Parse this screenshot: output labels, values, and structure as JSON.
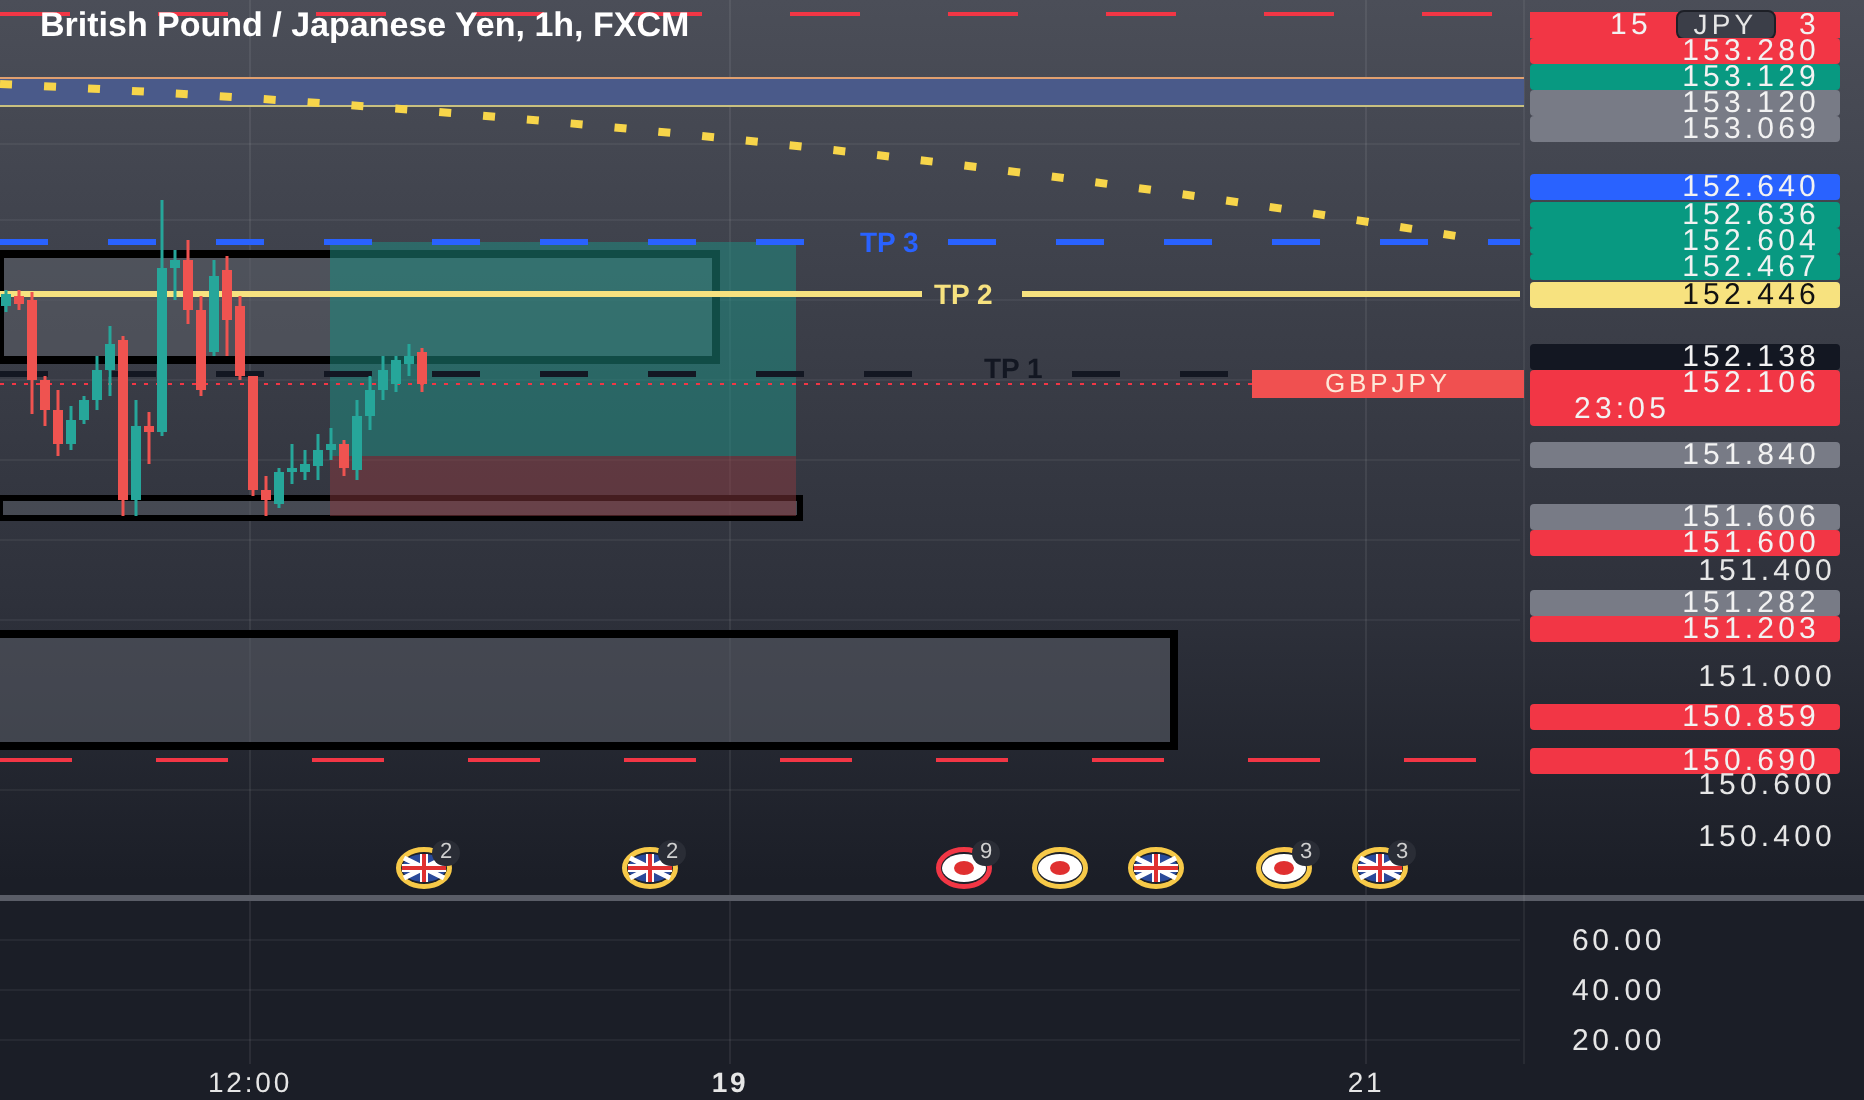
{
  "title": "British Pound / Japanese Yen, 1h, FXCM",
  "price_axis": [
    {
      "kind": "split",
      "color": "#f23645",
      "text": "15",
      "text_end": "3",
      "badge": "JPY"
    },
    {
      "kind": "tag",
      "color": "#f23645",
      "text": "153.280"
    },
    {
      "kind": "tag",
      "color": "#089981",
      "text": "153.129"
    },
    {
      "kind": "tag",
      "color": "#787b86",
      "text": "153.120"
    },
    {
      "kind": "tag",
      "color": "#787b86",
      "text": "153.069"
    },
    {
      "kind": "tag",
      "color": "#2962ff",
      "text": "152.640"
    },
    {
      "kind": "tag",
      "color": "#089981",
      "text": "152.636"
    },
    {
      "kind": "tag",
      "color": "#089981",
      "text": "152.604"
    },
    {
      "kind": "tag",
      "color": "#089981",
      "text": "152.467"
    },
    {
      "kind": "tag",
      "color": "#f7e27f",
      "text": "152.446"
    },
    {
      "kind": "tag",
      "color": "#131722",
      "text": "152.138"
    },
    {
      "kind": "tag",
      "color": "#f23645",
      "text": "152.106",
      "countdown": "23:05"
    },
    {
      "kind": "tag",
      "color": "#787b86",
      "text": "151.840"
    },
    {
      "kind": "tag",
      "color": "#787b86",
      "text": "151.606"
    },
    {
      "kind": "tag",
      "color": "#f23645",
      "text": "151.600"
    },
    {
      "kind": "tick",
      "text": "151.400"
    },
    {
      "kind": "tag",
      "color": "#787b86",
      "text": "151.282"
    },
    {
      "kind": "tag",
      "color": "#f23645",
      "text": "151.203"
    },
    {
      "kind": "tick",
      "text": "151.000"
    },
    {
      "kind": "tag",
      "color": "#f23645",
      "text": "150.859"
    },
    {
      "kind": "tag",
      "color": "#f23645",
      "text": "150.690"
    },
    {
      "kind": "tick",
      "text": "150.600"
    },
    {
      "kind": "tick",
      "text": "150.400"
    }
  ],
  "target_lines": [
    {
      "label": "TP 3",
      "color": "#2962ff",
      "kind": "dashed"
    },
    {
      "label": "TP 2",
      "color": "#f7e27f",
      "kind": "solid"
    },
    {
      "label": "TP 1",
      "color": "#131722",
      "kind": "dashed"
    }
  ],
  "symbol_label": "GBPJPY",
  "events": [
    {
      "kind": "uk",
      "count": "2",
      "color": "#f7c948"
    },
    {
      "kind": "uk",
      "count": "2",
      "color": "#f7c948"
    },
    {
      "kind": "japan",
      "count": "9",
      "color": "#f23645"
    },
    {
      "kind": "japan",
      "color": "#f7c948"
    },
    {
      "kind": "uk",
      "color": "#f7c948"
    },
    {
      "kind": "japan",
      "count": "3",
      "color": "#f7c948"
    },
    {
      "kind": "uk",
      "count": "3",
      "color": "#f7c948"
    }
  ],
  "oscillator_axis": [
    "60.00",
    "40.00",
    "20.00"
  ],
  "time_axis": [
    {
      "text": "12:00",
      "bold": false
    },
    {
      "text": "19",
      "bold": true
    },
    {
      "text": "21",
      "bold": false
    }
  ]
}
